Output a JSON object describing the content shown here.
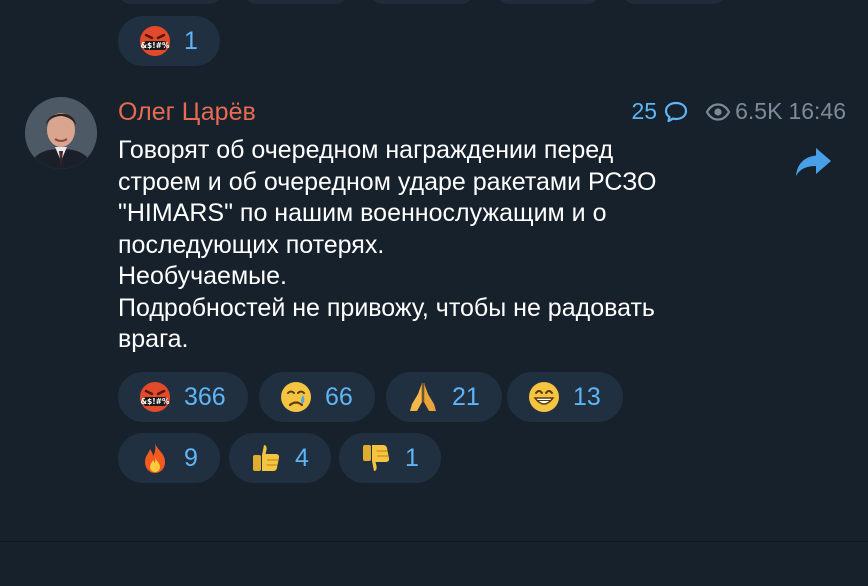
{
  "previous_post": {
    "reactions": [
      {
        "icon": "angry-face-icon",
        "count": "1"
      }
    ]
  },
  "post": {
    "author": "Олег Царёв",
    "comments_count": "25",
    "views": "6.5K",
    "time": "16:46",
    "text": "Говорят об очередном награждении перед\nстроем и об очередном ударе ракетами РСЗО\n\"HIMARS\" по нашим военнослужащим и о\nпоследующих потерях.\nНеобучаемые.\nПодробностей не привожу, чтобы не радовать\nврага.",
    "reactions": [
      {
        "icon": "angry-face-icon",
        "count": "366"
      },
      {
        "icon": "crying-face-icon",
        "count": "66"
      },
      {
        "icon": "praying-hands-icon",
        "count": "21"
      },
      {
        "icon": "grinning-face-icon",
        "count": "13"
      },
      {
        "icon": "fire-icon",
        "count": "9"
      },
      {
        "icon": "thumbs-up-icon",
        "count": "4"
      },
      {
        "icon": "thumbs-down-icon",
        "count": "1"
      }
    ]
  },
  "colors": {
    "background": "#17212b",
    "author": "#e66b52",
    "accent": "#5eb5f7",
    "pill": "#213040"
  }
}
